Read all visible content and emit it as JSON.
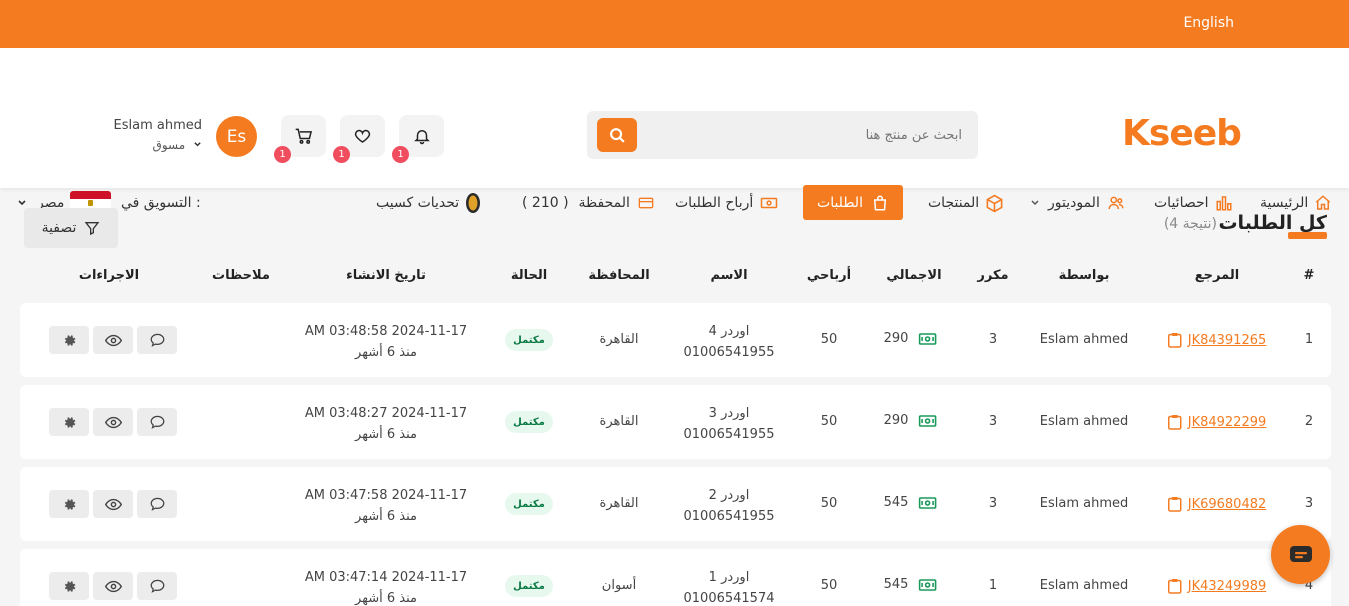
{
  "topbar": {
    "language_link": "English"
  },
  "header": {
    "logo_text": "Kseeb",
    "search_placeholder": "ابحث عن منتج هنا",
    "badges": {
      "notifications": "1",
      "wishlist": "1",
      "cart": "1"
    },
    "user": {
      "avatar_initials": "Es",
      "name": "Eslam ahmed",
      "role": "مسوق"
    }
  },
  "nav": {
    "home": "الرئيسية",
    "stats": "احصائيات",
    "moderator": "الموديتور",
    "products": "المنتجات",
    "orders": "الطلبات",
    "order_profits": "أرباح الطلبات",
    "wallet": "المحفظة",
    "wallet_amount": "( 210 )",
    "challenges": "تحديات كسيب",
    "marketing_in_label": "التسويق في :",
    "country": "مصر"
  },
  "page": {
    "title": "كل الطلبات",
    "result_count": "(4 نتيجة)",
    "filter_label": "تصفية"
  },
  "table": {
    "headers": {
      "num": "#",
      "ref": "المرجع",
      "by": "بواسطة",
      "repeat": "مكرر",
      "total": "الاجمالي",
      "profit": "أرباحي",
      "name": "الاسم",
      "governorate": "المحافظة",
      "status": "الحالة",
      "created": "تاريخ الانشاء",
      "notes": "ملاحظات",
      "actions": "الاجراءات"
    },
    "rows": [
      {
        "num": "1",
        "ref": "JK84391265",
        "by": "Eslam ahmed",
        "repeat": "3",
        "total": "290",
        "profit": "50",
        "name": "اوردر 4",
        "phone": "01006541955",
        "governorate": "القاهرة",
        "status": "مكتمل",
        "date": "AM 03:48:58 2024-11-17",
        "ago": "منذ 6 أشهر"
      },
      {
        "num": "2",
        "ref": "JK84922299",
        "by": "Eslam ahmed",
        "repeat": "3",
        "total": "290",
        "profit": "50",
        "name": "اوردر 3",
        "phone": "01006541955",
        "governorate": "القاهرة",
        "status": "مكتمل",
        "date": "AM 03:48:27 2024-11-17",
        "ago": "منذ 6 أشهر"
      },
      {
        "num": "3",
        "ref": "JK69680482",
        "by": "Eslam ahmed",
        "repeat": "3",
        "total": "545",
        "profit": "50",
        "name": "اوردر 2",
        "phone": "01006541955",
        "governorate": "القاهرة",
        "status": "مكتمل",
        "date": "AM 03:47:58 2024-11-17",
        "ago": "منذ 6 أشهر"
      },
      {
        "num": "4",
        "ref": "JK43249989",
        "by": "Eslam ahmed",
        "repeat": "1",
        "total": "545",
        "profit": "50",
        "name": "اوردر 1",
        "phone": "01006541574",
        "governorate": "أسوان",
        "status": "مكتمل",
        "date": "AM 03:47:14 2024-11-17",
        "ago": "منذ 6 أشهر"
      }
    ]
  },
  "colors": {
    "accent": "#f47b20",
    "badge": "#f04e5e",
    "status_bg": "#e7f8ef",
    "status_text": "#0a7a43",
    "money_icon": "#1a9a5a"
  }
}
